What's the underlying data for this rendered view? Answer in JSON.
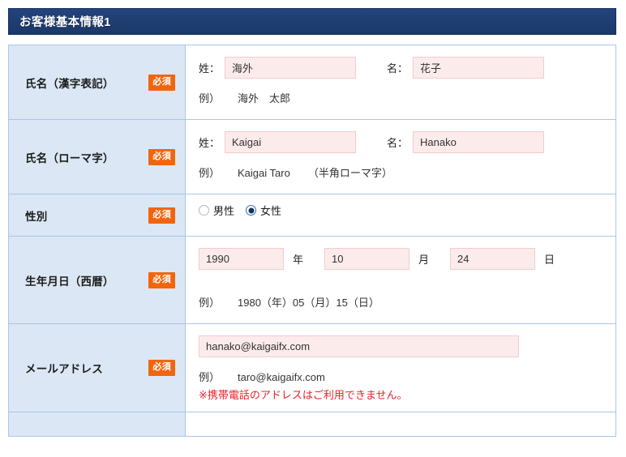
{
  "section": {
    "title": "お客様基本情報1",
    "header_bg": "#1d3c6e",
    "badge_bg": "#f2650f",
    "label_bg": "#dbe7f4",
    "border_color": "#a9c7e8",
    "input_bg": "#fcebeb",
    "input_border": "#f0cdcd",
    "warning_color": "#e8232a"
  },
  "badge": {
    "required": "必須"
  },
  "rows": {
    "name_kanji": {
      "label": "氏名（漢字表記）",
      "sei_label": "姓：",
      "sei_value": "海外",
      "mei_label": "名：",
      "mei_value": "花子",
      "hint": "例）",
      "hint_value": "海外　太郎"
    },
    "name_romaji": {
      "label": "氏名（ローマ字）",
      "sei_label": "姓：",
      "sei_value": "Kaigai",
      "mei_label": "名：",
      "mei_value": "Hanako",
      "hint": "例）",
      "hint_value": "Kaigai Taro",
      "hint_note": "（半角ローマ字）"
    },
    "gender": {
      "label": "性別",
      "options": [
        {
          "label": "男性",
          "selected": false
        },
        {
          "label": "女性",
          "selected": true
        }
      ]
    },
    "birthdate": {
      "label": "生年月日（西暦）",
      "year_value": "1990",
      "year_unit": "年",
      "month_value": "10",
      "month_unit": "月",
      "day_value": "24",
      "day_unit": "日",
      "hint": "例）",
      "hint_value": "1980（年）05（月）15（日）"
    },
    "email": {
      "label": "メールアドレス",
      "value": "hanako@kaigaifx.com",
      "hint": "例）",
      "hint_value": "taro@kaigaifx.com",
      "warning": "※携帯電話のアドレスはご利用できません。"
    }
  }
}
